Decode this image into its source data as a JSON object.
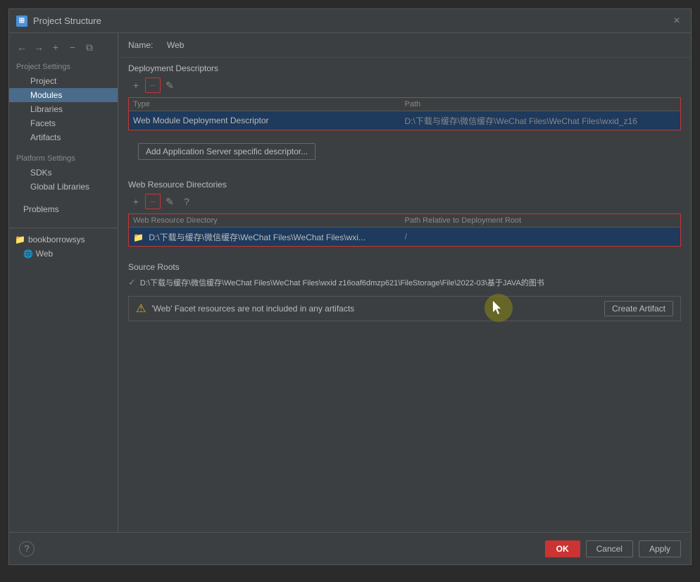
{
  "dialog": {
    "title": "Project Structure",
    "close_label": "×"
  },
  "sidebar": {
    "nav_back": "←",
    "nav_forward": "→",
    "add_btn": "+",
    "remove_btn": "−",
    "copy_btn": "⧉",
    "project_settings_label": "Project Settings",
    "items": [
      {
        "id": "project",
        "label": "Project",
        "indent": 1
      },
      {
        "id": "modules",
        "label": "Modules",
        "indent": 1,
        "active": true
      },
      {
        "id": "libraries",
        "label": "Libraries",
        "indent": 1
      },
      {
        "id": "facets",
        "label": "Facets",
        "indent": 1
      },
      {
        "id": "artifacts",
        "label": "Artifacts",
        "indent": 1
      }
    ],
    "platform_settings_label": "Platform Settings",
    "platform_items": [
      {
        "id": "sdks",
        "label": "SDKs",
        "indent": 1
      },
      {
        "id": "global-libraries",
        "label": "Global Libraries",
        "indent": 1
      }
    ],
    "other_items": [
      {
        "id": "problems",
        "label": "Problems",
        "indent": 0
      }
    ],
    "tree": {
      "project_name": "bookborrowsys",
      "module_name": "Web"
    }
  },
  "main": {
    "name_label": "Name:",
    "name_value": "Web",
    "deployment_descriptors_title": "Deployment Descriptors",
    "add_btn": "+",
    "remove_btn": "−",
    "edit_btn": "✎",
    "table1": {
      "headers": [
        "Type",
        "Path"
      ],
      "rows": [
        {
          "type": "Web Module Deployment Descriptor",
          "path": "D:\\下载与缓存\\微信缓存\\WeChat Files\\WeChat Files\\wxid_z16"
        }
      ]
    },
    "add_descriptor_btn": "Add Application Server specific descriptor...",
    "web_resource_title": "Web Resource Directories",
    "wr_add": "+",
    "wr_remove": "−",
    "wr_edit": "✎",
    "wr_question": "?",
    "table2": {
      "headers": [
        "Web Resource Directory",
        "Path Relative to Deployment Root"
      ],
      "rows": [
        {
          "directory": "D:\\下载与缓存\\微信缓存\\WeChat Files\\WeChat Files\\wxi...",
          "relative_path": "/"
        }
      ]
    },
    "source_roots_title": "Source Roots",
    "source_roots": [
      {
        "checked": true,
        "path": "D:\\下载与缓存\\微信缓存\\WeChat Files\\WeChat Files\\wxid z16oaf6dmzp621\\FileStorage\\File\\2022-03\\基于JAVA的图书"
      }
    ],
    "warning_text": "'Web' Facet resources are not included in any artifacts",
    "create_artifact_btn": "Create Artifact"
  },
  "footer": {
    "help_label": "?",
    "ok_label": "OK",
    "cancel_label": "Cancel",
    "apply_label": "Apply"
  }
}
